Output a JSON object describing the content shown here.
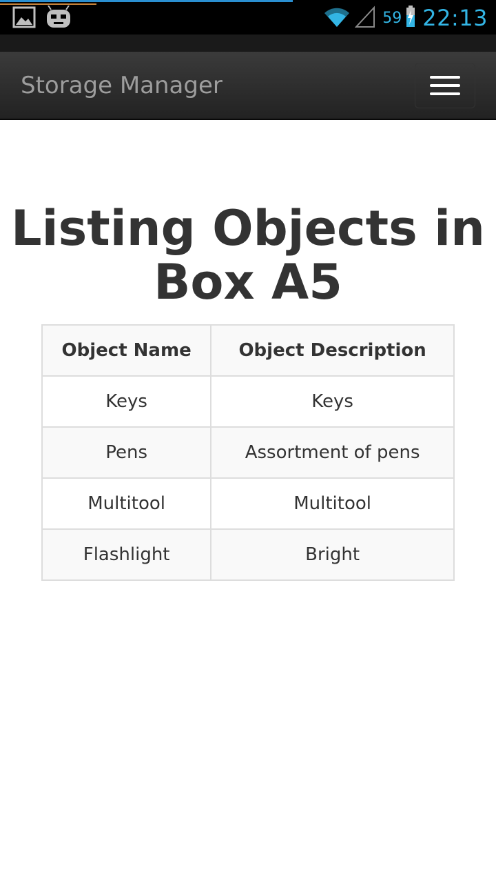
{
  "status_bar": {
    "battery_level": "59",
    "clock": "22:13",
    "colors": {
      "accent": "#33b5e5",
      "background": "#000000"
    },
    "icons": [
      "image-notification-icon",
      "cyanogen-mascot-icon",
      "wifi-icon",
      "cell-signal-icon",
      "battery-charging-icon"
    ]
  },
  "navbar": {
    "brand": "Storage Manager",
    "menu_icon": "hamburger-menu-icon"
  },
  "main": {
    "title": "Listing Objects in Box A5",
    "table": {
      "headers": [
        "Object Name",
        "Object Description"
      ],
      "rows": [
        {
          "name": "Keys",
          "description": "Keys"
        },
        {
          "name": "Pens",
          "description": "Assortment of pens"
        },
        {
          "name": "Multitool",
          "description": "Multitool"
        },
        {
          "name": "Flashlight",
          "description": "Bright"
        }
      ]
    }
  }
}
